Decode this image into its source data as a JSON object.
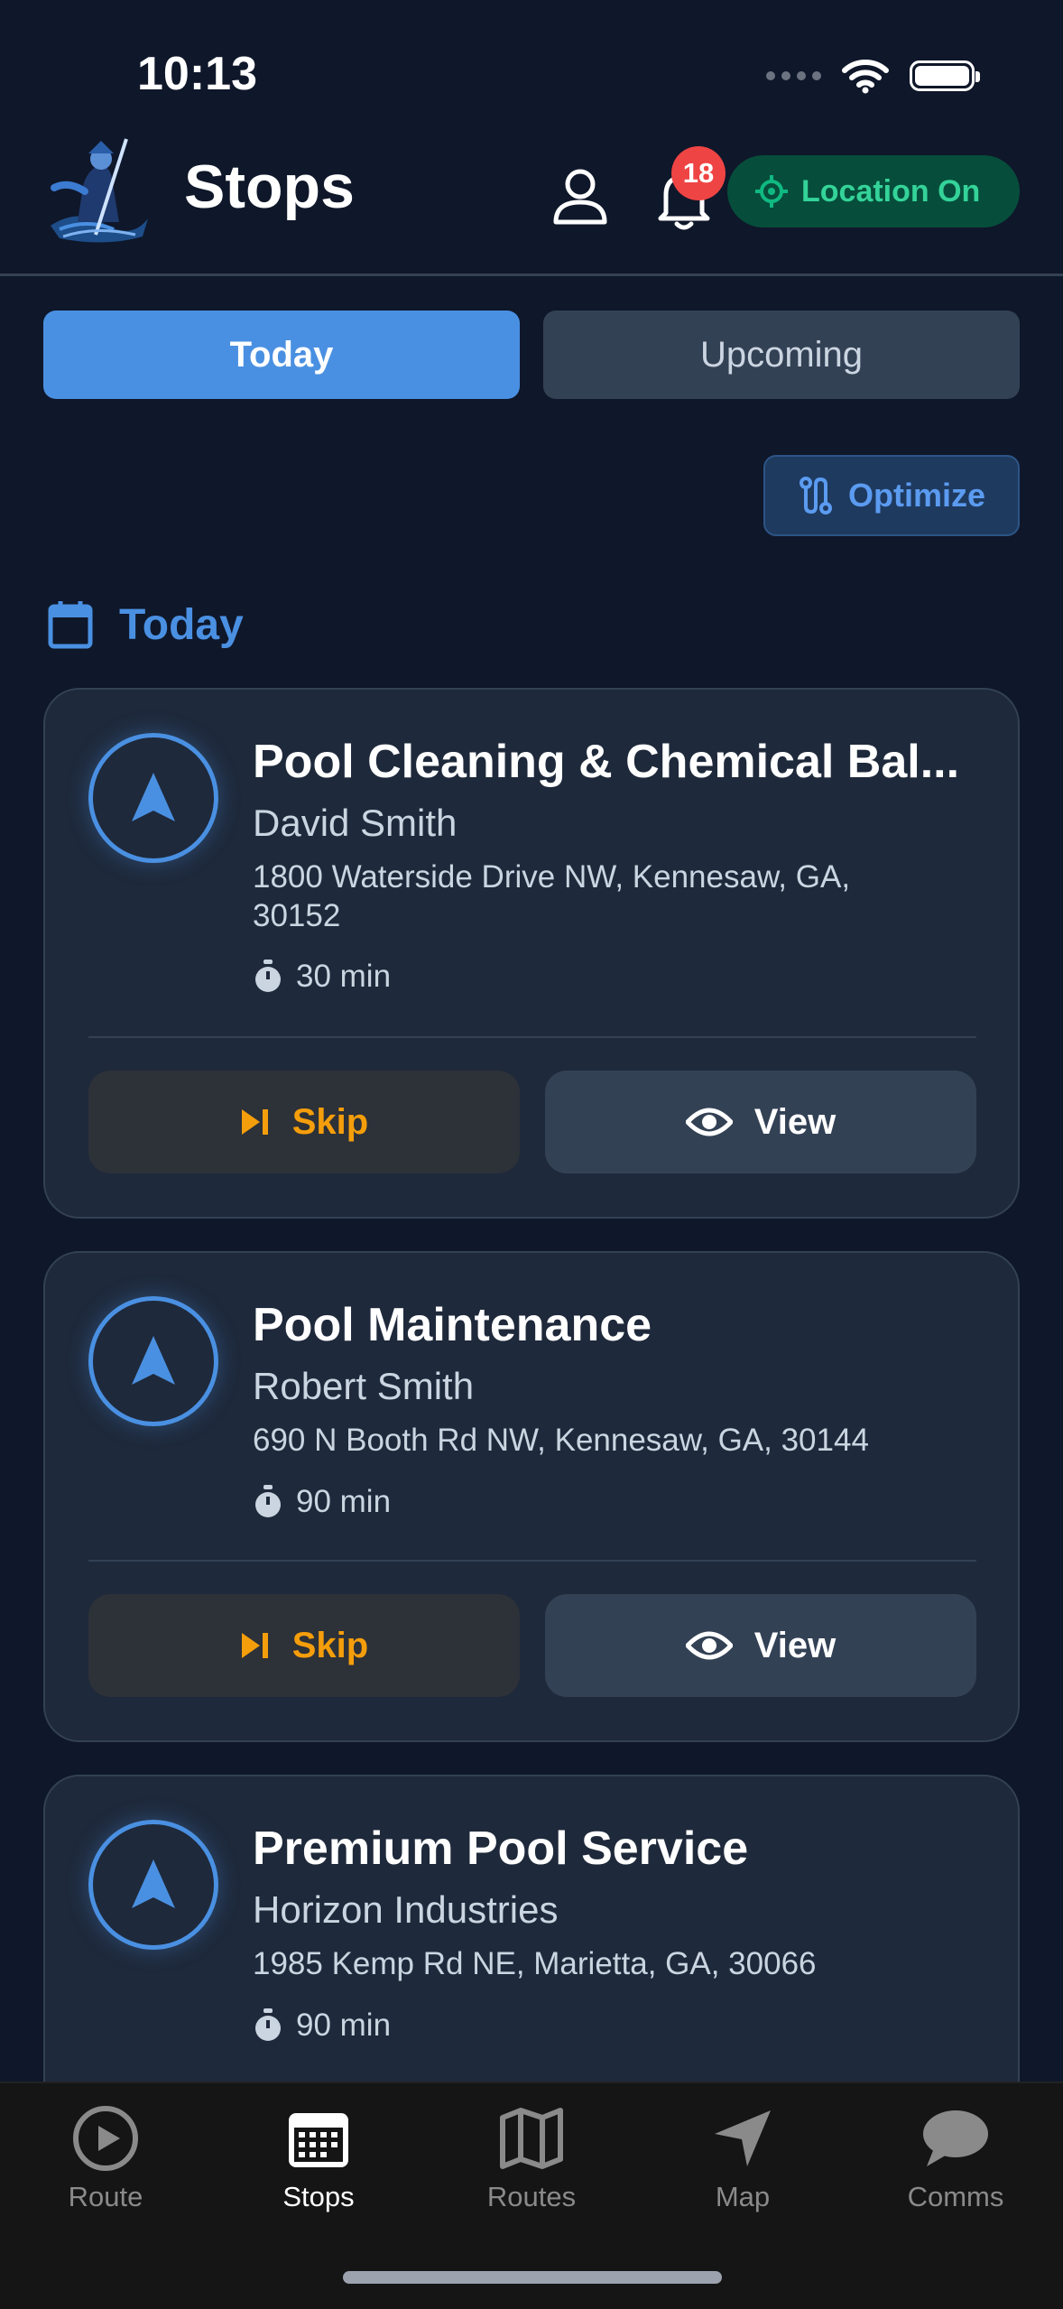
{
  "status_bar": {
    "time": "10:13"
  },
  "header": {
    "title": "Stops",
    "notification_count": "18",
    "location_label": "Location On"
  },
  "tabs": [
    {
      "label": "Today",
      "active": true
    },
    {
      "label": "Upcoming",
      "active": false
    }
  ],
  "optimize_label": "Optimize",
  "section": {
    "title": "Today"
  },
  "stops": [
    {
      "title": "Pool Cleaning & Chemical Bal...",
      "customer": "David Smith",
      "address": "1800 Waterside Drive NW, Kennesaw, GA, 30152",
      "duration": "30 min",
      "skip_label": "Skip",
      "view_label": "View"
    },
    {
      "title": "Pool Maintenance",
      "customer": "Robert Smith",
      "address": "690 N Booth Rd NW, Kennesaw, GA, 30144",
      "duration": "90 min",
      "skip_label": "Skip",
      "view_label": "View"
    },
    {
      "title": "Premium Pool Service",
      "customer": "Horizon Industries",
      "address": "1985 Kemp Rd NE, Marietta, GA, 30066",
      "duration": "90 min"
    }
  ],
  "bottom_nav": [
    {
      "label": "Route",
      "icon": "play-circle-icon",
      "active": false
    },
    {
      "label": "Stops",
      "icon": "calendar-grid-icon",
      "active": true
    },
    {
      "label": "Routes",
      "icon": "map-icon",
      "active": false
    },
    {
      "label": "Map",
      "icon": "navigation-arrow-icon",
      "active": false
    },
    {
      "label": "Comms",
      "icon": "chat-bubble-icon",
      "active": false
    }
  ],
  "colors": {
    "background": "#0f172a",
    "card": "#1e293b",
    "accent": "#4a90e2",
    "skip": "#f59e0b",
    "location": "#34d399",
    "badge": "#ef4444"
  }
}
